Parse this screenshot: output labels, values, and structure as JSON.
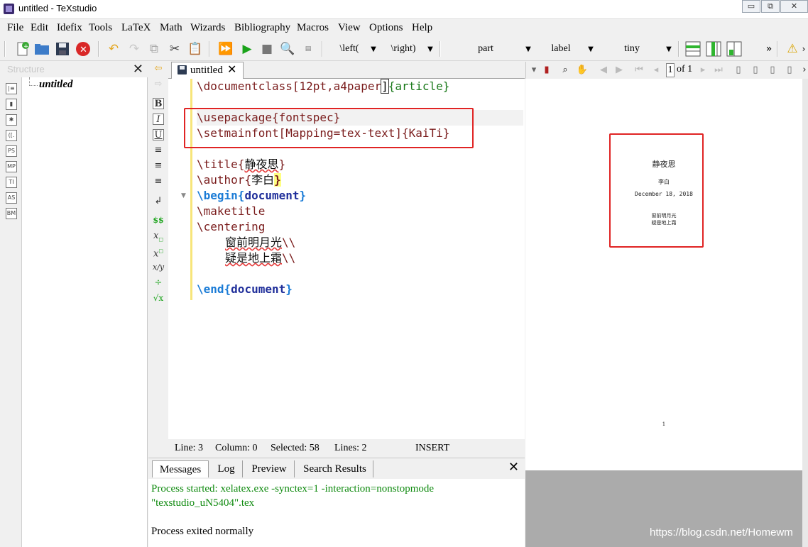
{
  "window": {
    "title": "untitled - TeXstudio",
    "buttons": [
      "▭",
      "⧉",
      "✕"
    ]
  },
  "menu": [
    "File",
    "Edit",
    "Idefix",
    "Tools",
    "LaTeX",
    "Math",
    "Wizards",
    "Bibliography",
    "Macros",
    "View",
    "Options",
    "Help"
  ],
  "toolbar": {
    "combos": [
      "\\left(",
      "\\right)",
      "part",
      "label",
      "tiny"
    ],
    "more": "»"
  },
  "structure": {
    "title": "Structure",
    "close": "✕",
    "tree_root": "untitled",
    "side_icons": [
      "|≡",
      "▮",
      "✱",
      "([.",
      "PS",
      "MP",
      "TI",
      "AS",
      "BM"
    ]
  },
  "editor": {
    "tab": "untitled",
    "tab_close": "✕",
    "highlight_color": "#e02424",
    "lines": {
      "l1_cmd": "\\documentclass",
      "l1_opt": "[12pt,a4paper",
      "l1_br": "]",
      "l1_arg": "{article}",
      "l3_cmd": "\\usepackage",
      "l3_arg": "{fontspec}",
      "l4_cmd": "\\setmainfont",
      "l4_rest": "[Mapping=tex-text]{KaiTi}",
      "l6_cmd": "\\title",
      "l6_o": "{",
      "l6_t": "静夜思",
      "l6_c": "}",
      "l7_cmd": "\\author",
      "l7_o": "{",
      "l7_t": "李白",
      "l7_c": "}",
      "l8_cmd": "\\begin",
      "l8_o": "{",
      "l8_env": "document",
      "l8_c": "}",
      "l9_cmd": "\\maketitle",
      "l10_cmd": "\\centering",
      "l11_t": "窗前明月光",
      "l11_bs": "\\\\",
      "l12_t": "疑是地上霜",
      "l12_bs": "\\\\",
      "l14_cmd": "\\end",
      "l14_o": "{",
      "l14_env": "document",
      "l14_c": "}"
    }
  },
  "status": {
    "line": "Line: 3",
    "column": "Column: 0",
    "selected": "Selected: 58",
    "lines": "Lines: 2",
    "mode": "INSERT"
  },
  "bottom": {
    "tabs": [
      "Messages",
      "Log",
      "Preview",
      "Search Results"
    ],
    "close": "✕",
    "messages": [
      "Process started: xelatex.exe -synctex=1 -interaction=nonstopmode",
      "\"texstudio_uN5404\".tex",
      "Process exited normally"
    ]
  },
  "viewer": {
    "page_field": "1",
    "page_of": "of 1",
    "page": {
      "title": "静夜思",
      "author": "李白",
      "date": "December 18, 2018",
      "body_line1": "窗前明月光",
      "body_line2": "疑是地上霜",
      "page_number": "1"
    }
  },
  "watermark": "https://blog.csdn.net/Homewm"
}
